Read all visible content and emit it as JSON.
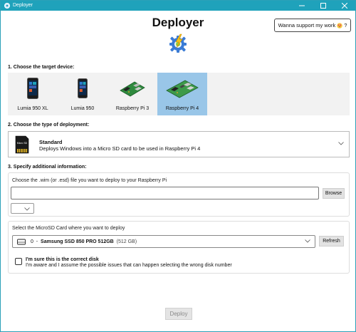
{
  "window": {
    "title": "Deployer",
    "titlebar_color": "#1fa2bb",
    "controls": [
      "minimize-icon",
      "maximize-icon",
      "close-icon"
    ]
  },
  "header": {
    "app_title": "Deployer",
    "logo_icon": "gear-lightning-icon",
    "support_label": "Wanna support my work",
    "support_suffix": "?",
    "support_icon": "heart-eyes-emoji-icon"
  },
  "step1": {
    "label": "1. Choose the target device:",
    "devices": [
      {
        "label": "Lumia 950 XL",
        "icon": "phone-icon",
        "selected": false
      },
      {
        "label": "Lumia 950",
        "icon": "phone-icon",
        "selected": false
      },
      {
        "label": "Raspberry Pi 3",
        "icon": "board-icon",
        "selected": false
      },
      {
        "label": "Raspberry Pi 4",
        "icon": "board-icon",
        "selected": true
      }
    ],
    "selected_color": "#99c6e8"
  },
  "step2": {
    "label": "2. Choose the type of deployment:",
    "selected_title": "Standard",
    "selected_description": "Deploys Windows into a Micro SD card to be used in Raspberry Pi 4",
    "sd_card_text": "Micro SD"
  },
  "step3": {
    "label": "3. Specify additional information:",
    "wim_prompt": "Choose the .wim (or .esd) file you want to deploy to your Raspberry Pi",
    "wim_value": "",
    "browse_label": "Browse",
    "edition_value": "",
    "sd_prompt": "Select the MicroSD Card where you want to deploy",
    "disk": {
      "index": "0",
      "separator": "-",
      "name": "Samsung SSD 850 PRO 512GB",
      "size": "(512 GB)"
    },
    "refresh_label": "Refresh",
    "confirm_title": "I'm sure this is the correct disk",
    "confirm_description": "I'm aware and I assume the possible issues that can happen selecting the wrong disk number",
    "confirm_checked": false
  },
  "footer": {
    "deploy_label": "Deploy",
    "deploy_enabled": false
  }
}
